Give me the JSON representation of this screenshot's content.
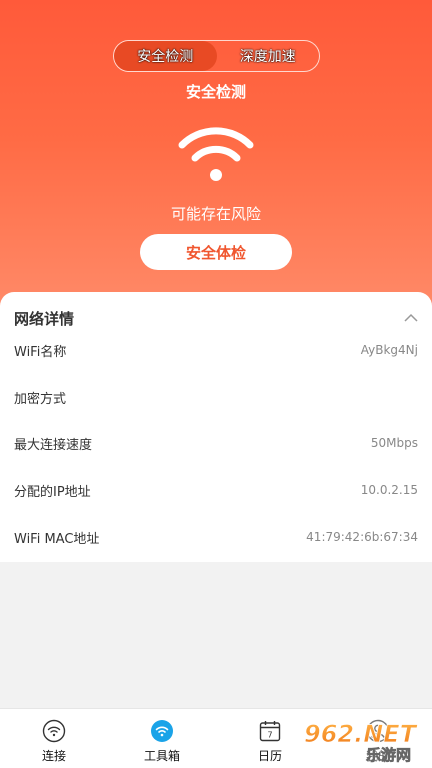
{
  "segment": {
    "tabs": [
      {
        "label": "安全检测",
        "active": true
      },
      {
        "label": "深度加速",
        "active": false
      }
    ]
  },
  "hero": {
    "title": "安全检测",
    "status": "可能存在风险",
    "button": "安全体检",
    "icon": "wifi-icon"
  },
  "details": {
    "title": "网络详情",
    "rows": [
      {
        "label": "WiFi名称",
        "value": "AyBkg4Nj"
      },
      {
        "label": "加密方式",
        "value": ""
      },
      {
        "label": "最大连接速度",
        "value": "50Mbps"
      },
      {
        "label": "分配的IP地址",
        "value": "10.0.2.15"
      },
      {
        "label": "WiFi MAC地址",
        "value": "41:79:42:6b:67:34"
      }
    ]
  },
  "tabbar": {
    "items": [
      {
        "label": "连接",
        "icon": "wifi-outline-icon"
      },
      {
        "label": "工具箱",
        "icon": "wifi-circle-icon",
        "active": true
      },
      {
        "label": "日历",
        "icon": "calendar-icon",
        "badge": "7"
      },
      {
        "label": "我的",
        "icon": "user-icon"
      }
    ]
  },
  "watermark": {
    "brand": "962.NET",
    "subtitle": "乐游网"
  },
  "colors": {
    "accent": "#f0562f",
    "active_tab": "#1aa3e8",
    "hero_top": "#ff5a3a",
    "hero_bottom": "#ff8a68"
  }
}
